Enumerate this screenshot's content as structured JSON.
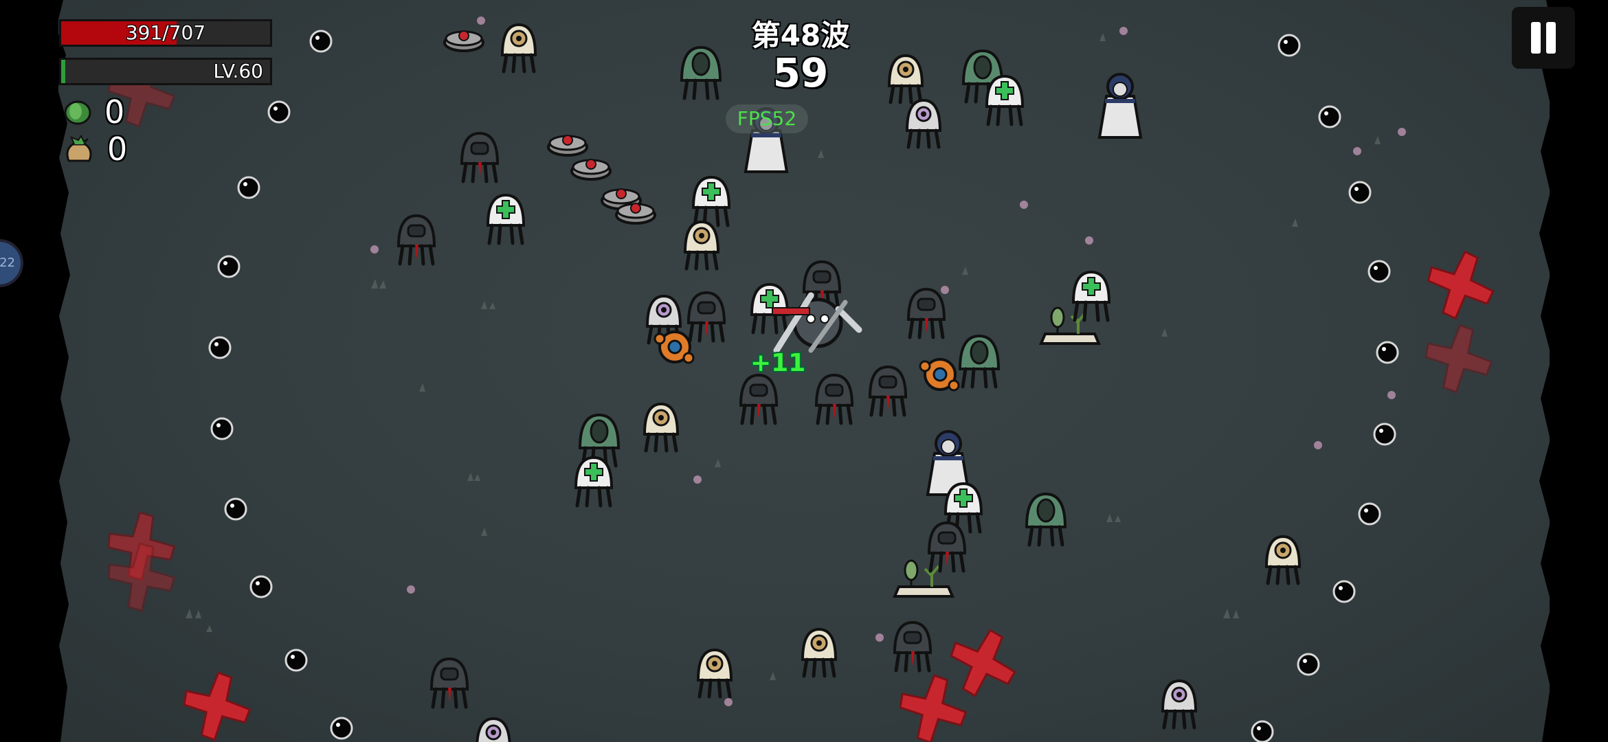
{
  "hud": {
    "hp_text": "391/707",
    "hp_current": 391,
    "hp_max": 707,
    "level_text": "LV.60",
    "xp_progress": 0.02,
    "materials_count": "0",
    "bag_count": "0",
    "wave_label": "第48波",
    "timer": "59",
    "fps_label": "FPS52"
  },
  "popups": {
    "heal": "+11"
  },
  "side_handle_text": "22",
  "colors": {
    "hp_fill": "#b3060d",
    "xp_fill": "#2e9e3a",
    "fps_text": "#4be04b",
    "heal_text": "#3df23d",
    "marker_red": "#c8262e",
    "arena_bg": "#374042"
  },
  "icons": {
    "materials": "green-leaf-coin-icon",
    "bag": "money-bag-icon",
    "pause": "pause-icon"
  }
}
